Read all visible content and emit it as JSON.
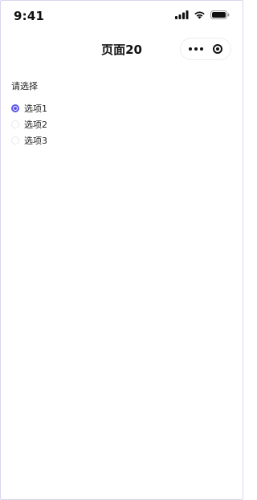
{
  "status_bar": {
    "time": "9:41",
    "icons": [
      "signal-icon",
      "wifi-icon",
      "battery-icon"
    ]
  },
  "nav": {
    "title": "页面20",
    "capsule_icons": [
      "more-icon",
      "target-icon"
    ]
  },
  "form": {
    "label": "请选择",
    "options": [
      {
        "label": "选项1",
        "checked": true
      },
      {
        "label": "选项2",
        "checked": false
      },
      {
        "label": "选项3",
        "checked": false
      }
    ]
  },
  "colors": {
    "accent": "#5b57e8",
    "border": "#d9d6ef"
  }
}
